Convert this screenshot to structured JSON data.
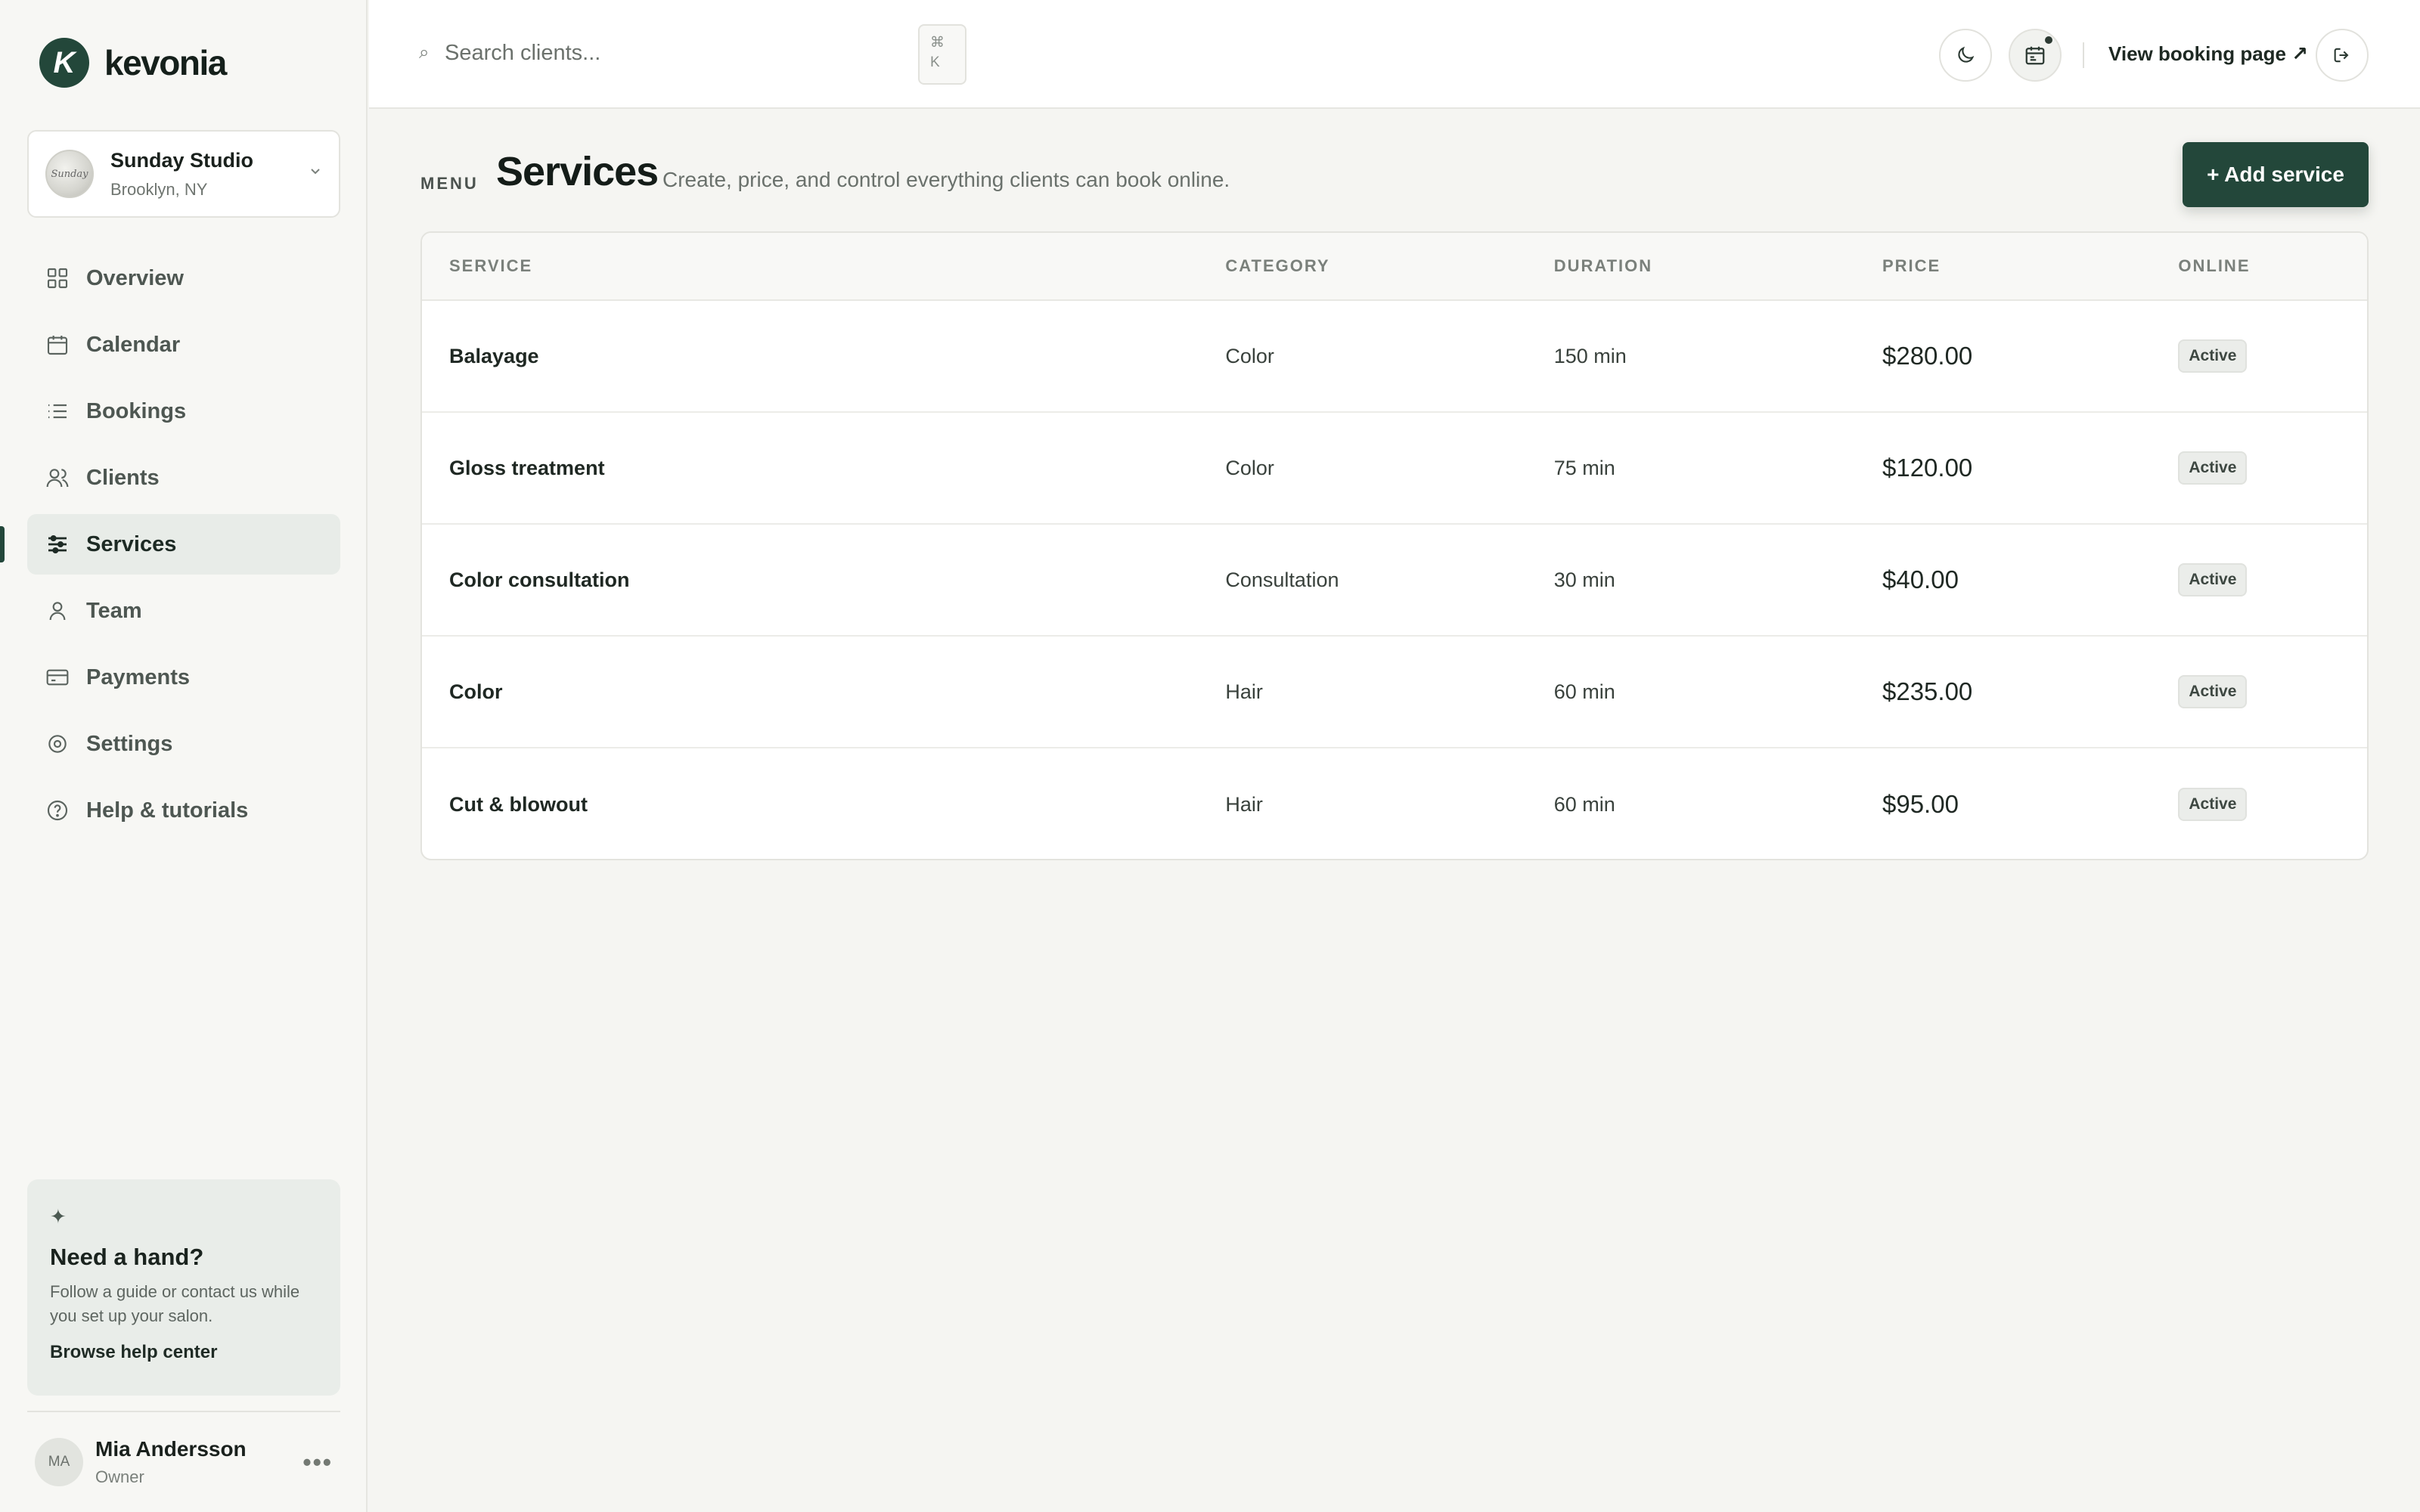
{
  "brand": {
    "name": "kevonia",
    "mark": "K"
  },
  "studio": {
    "name": "Sunday Studio",
    "location": "Brooklyn, NY",
    "avatar_text": "Sunday"
  },
  "nav": [
    {
      "label": "Overview",
      "icon": "grid-icon"
    },
    {
      "label": "Calendar",
      "icon": "calendar-icon"
    },
    {
      "label": "Bookings",
      "icon": "list-icon"
    },
    {
      "label": "Clients",
      "icon": "users-icon"
    },
    {
      "label": "Services",
      "icon": "sliders-icon",
      "active": true
    },
    {
      "label": "Team",
      "icon": "person-icon"
    },
    {
      "label": "Payments",
      "icon": "card-icon"
    },
    {
      "label": "Settings",
      "icon": "gear-icon"
    },
    {
      "label": "Help & tutorials",
      "icon": "help-icon"
    }
  ],
  "help_card": {
    "spark": "✦",
    "title": "Need a hand?",
    "description": "Follow a guide or contact us while you set up your salon.",
    "link": "Browse help center"
  },
  "user": {
    "initials": "MA",
    "name": "Mia Andersson",
    "role": "Owner"
  },
  "topbar": {
    "search_placeholder": "Search clients...",
    "shortcut": [
      "⌘",
      "K"
    ],
    "view_booking": "View booking page ↗"
  },
  "page": {
    "eyebrow": "MENU",
    "title": "Services",
    "subtitle": "Create, price, and control everything clients can book online.",
    "add_button": "+ Add service"
  },
  "table": {
    "columns": [
      "SERVICE",
      "CATEGORY",
      "DURATION",
      "PRICE",
      "ONLINE"
    ],
    "rows": [
      {
        "service": "Balayage",
        "category": "Color",
        "duration": "150 min",
        "price": "$280.00",
        "online": "Active"
      },
      {
        "service": "Gloss treatment",
        "category": "Color",
        "duration": "75 min",
        "price": "$120.00",
        "online": "Active"
      },
      {
        "service": "Color consultation",
        "category": "Consultation",
        "duration": "30 min",
        "price": "$40.00",
        "online": "Active"
      },
      {
        "service": "Color",
        "category": "Hair",
        "duration": "60 min",
        "price": "$235.00",
        "online": "Active"
      },
      {
        "service": "Cut & blowout",
        "category": "Hair",
        "duration": "60 min",
        "price": "$95.00",
        "online": "Active"
      }
    ]
  },
  "colors": {
    "brand": "#23473a",
    "background": "#f5f5f2"
  }
}
